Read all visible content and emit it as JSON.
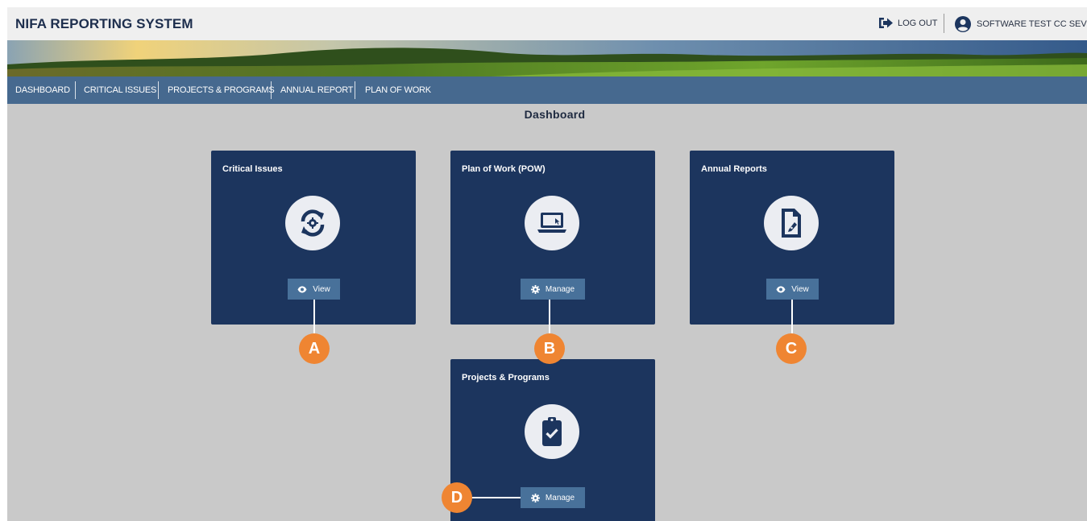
{
  "header": {
    "app_title": "NIFA REPORTING SYSTEM",
    "logout_label": "LOG OUT",
    "user_label": "SOFTWARE TEST CC SEVENTY"
  },
  "nav": {
    "items": [
      {
        "label": "DASHBOARD"
      },
      {
        "label": "CRITICAL ISSUES"
      },
      {
        "label": "PROJECTS & PROGRAMS"
      },
      {
        "label": "ANNUAL REPORT"
      },
      {
        "label": "PLAN OF WORK"
      }
    ]
  },
  "page": {
    "title": "Dashboard"
  },
  "cards": [
    {
      "title": "Critical Issues",
      "icon": "sync-gear-icon",
      "button_label": "View",
      "button_icon": "eye-icon"
    },
    {
      "title": "Plan of Work (POW)",
      "icon": "laptop-icon",
      "button_label": "Manage",
      "button_icon": "gear-icon"
    },
    {
      "title": "Annual Reports",
      "icon": "file-signature-icon",
      "button_label": "View",
      "button_icon": "eye-icon"
    },
    {
      "title": "Projects & Programs",
      "icon": "clipboard-check-icon",
      "button_label": "Manage",
      "button_icon": "gear-icon"
    }
  ],
  "callouts": [
    "A",
    "B",
    "C",
    "D"
  ],
  "colors": {
    "card_bg": "#1c355e",
    "nav_bg": "#46698f",
    "button_bg": "#48719a",
    "callout_bg": "#ef8532",
    "page_bg": "#c9c9c9"
  }
}
